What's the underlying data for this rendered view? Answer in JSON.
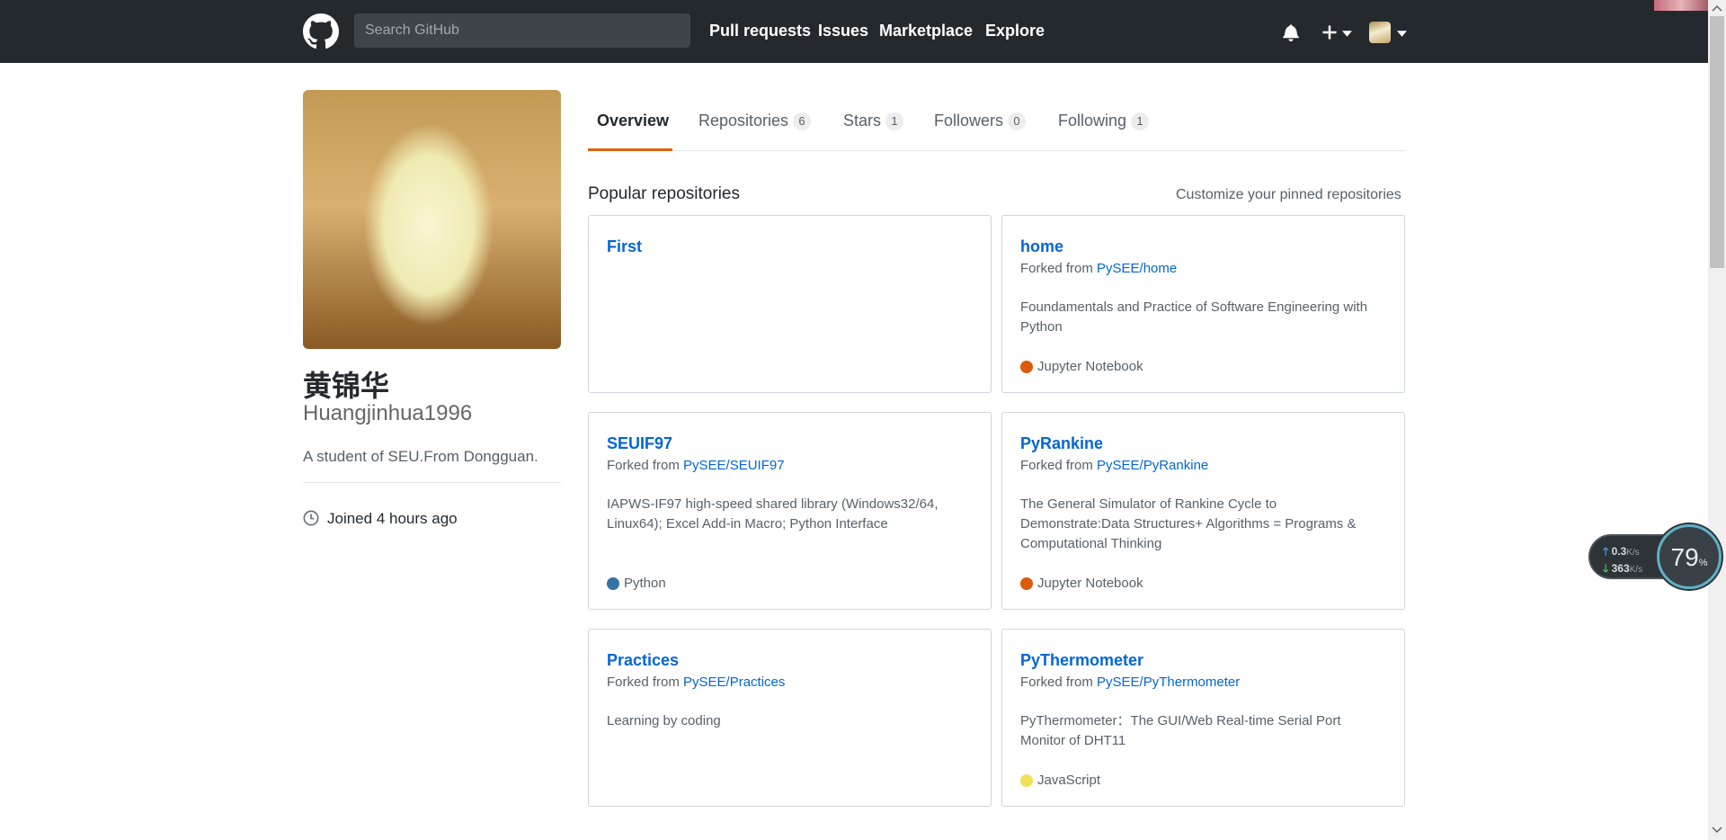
{
  "header": {
    "search_placeholder": "Search GitHub",
    "nav": [
      "Pull requests",
      "Issues",
      "Marketplace",
      "Explore"
    ],
    "icons": [
      "github-logo",
      "bell-icon",
      "plus-icon",
      "chevron-down-icon",
      "avatar"
    ]
  },
  "profile": {
    "name": "黄锦华",
    "login": "Huangjinhua1996",
    "bio": "A student of SEU.From Dongguan.",
    "joined_prefix": "Joined ",
    "joined_time": "4 hours ago"
  },
  "tabs": [
    {
      "label": "Overview",
      "count": null,
      "active": true
    },
    {
      "label": "Repositories",
      "count": "6"
    },
    {
      "label": "Stars",
      "count": "1"
    },
    {
      "label": "Followers",
      "count": "0"
    },
    {
      "label": "Following",
      "count": "1"
    }
  ],
  "pinned": {
    "title": "Popular repositories",
    "customize": "Customize your pinned repositories",
    "forked_prefix": "Forked from ",
    "repos": [
      {
        "name": "First",
        "forked_from": "",
        "description": "",
        "language": "",
        "lang_color": ""
      },
      {
        "name": "home",
        "forked_from": "PySEE/home",
        "description": "Foundamentals and Practice of Software Engineering with Python",
        "language": "Jupyter Notebook",
        "lang_color": "#DA5B0B"
      },
      {
        "name": "SEUIF97",
        "forked_from": "PySEE/SEUIF97",
        "description": "IAPWS-IF97 high-speed shared library (Windows32/64, Linux64); Excel Add-in Macro; Python Interface",
        "language": "Python",
        "lang_color": "#3572A5"
      },
      {
        "name": "PyRankine",
        "forked_from": "PySEE/PyRankine",
        "description": "The General Simulator of Rankine Cycle to Demonstrate:Data Structures+ Algorithms = Programs & Computational Thinking",
        "language": "Jupyter Notebook",
        "lang_color": "#DA5B0B"
      },
      {
        "name": "Practices",
        "forked_from": "PySEE/Practices",
        "description": "Learning by coding",
        "language": "",
        "lang_color": ""
      },
      {
        "name": "PyThermometer",
        "forked_from": "PySEE/PyThermometer",
        "description": "PyThermometer：The GUI/Web Real-time Serial Port Monitor of DHT11",
        "language": "JavaScript",
        "lang_color": "#F1E05A"
      }
    ]
  },
  "speed_widget": {
    "up": "0.3",
    "up_unit": "K/s",
    "down": "363",
    "down_unit": "K/s",
    "percent": "79",
    "percent_unit": "%"
  }
}
